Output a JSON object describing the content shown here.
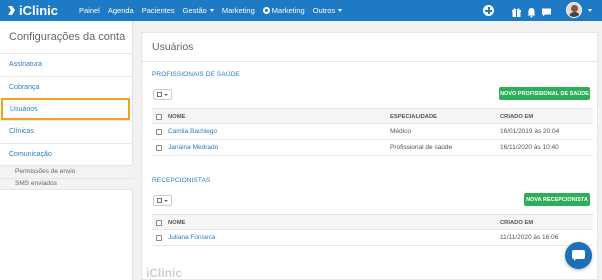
{
  "app": {
    "logo_text": "iClinic"
  },
  "nav": {
    "items": [
      "Painel",
      "Agenda",
      "Pacientes",
      "Gestão",
      "Marketing",
      "Marketing",
      "Outros"
    ]
  },
  "sidebar": {
    "title": "Configurações da conta",
    "items": [
      "Assinatura",
      "Cobrança",
      "Usuários",
      "Clínicas",
      "Comunicação"
    ],
    "subitems": [
      "Permissões de envio",
      "SMS enviados"
    ]
  },
  "main": {
    "page_title": "Usuários",
    "professionals": {
      "section_title": "PROFISSIONAIS DE SAÚDE",
      "button_label": "NOVO PROFISSIONAL DE SAÚDE",
      "headers": [
        "NOME",
        "ESPECIALIDADE",
        "CRIADO EM"
      ],
      "rows": [
        {
          "name": "Camila Bachiego",
          "specialty": "Médico",
          "created": "16/01/2019 às 20:04"
        },
        {
          "name": "Janaina Medrado",
          "specialty": "Profissional de saúde",
          "created": "16/11/2020 às 10:40"
        }
      ]
    },
    "receptionists": {
      "section_title": "RECEPCIONISTAS",
      "button_label": "NOVA RECEPCIONISTA",
      "headers": [
        "NOME",
        "CRIADO EM"
      ],
      "rows": [
        {
          "name": "Juliana Fonseca",
          "created": "11/11/2020 às 16:06"
        }
      ]
    }
  },
  "footer": {
    "watermark_text": "iClinic"
  },
  "colors": {
    "topbar": "#1e7ac4",
    "link": "#2a7cc4",
    "green_button": "#2fae5a",
    "active_outline": "#f0a21b"
  },
  "icons": {
    "topbar_right": [
      "plus-circle-icon",
      "gift-icon",
      "bell-icon",
      "chat-icon",
      "avatar",
      "chevron-down-icon"
    ],
    "chat_widget": "chat-bubble-icon"
  }
}
